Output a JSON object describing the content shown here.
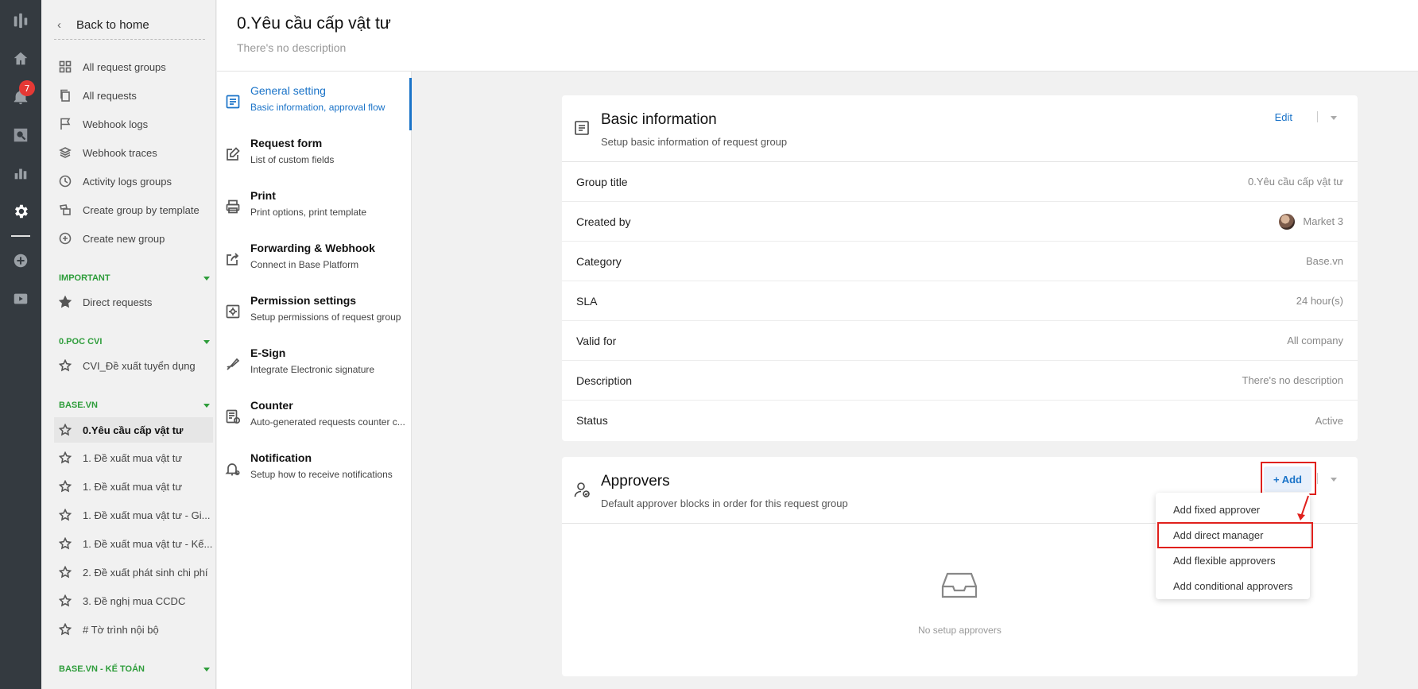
{
  "rail": {
    "notification_count": "7"
  },
  "sidebar": {
    "back_label": "Back to home",
    "menu": [
      {
        "label": "All request groups"
      },
      {
        "label": "All requests"
      },
      {
        "label": "Webhook logs"
      },
      {
        "label": "Webhook traces"
      },
      {
        "label": "Activity logs groups"
      },
      {
        "label": "Create group by template"
      },
      {
        "label": "Create new group"
      }
    ],
    "sections": [
      {
        "title": "IMPORTANT",
        "items": [
          {
            "label": "Direct requests"
          }
        ]
      },
      {
        "title": "0.POC CVI",
        "items": [
          {
            "label": "CVI_Đề xuất tuyển dụng"
          }
        ]
      },
      {
        "title": "BASE.VN",
        "items": [
          {
            "label": "0.Yêu cầu cấp vật tư"
          },
          {
            "label": "1. Đề xuất mua vật tư"
          },
          {
            "label": "1. Đề xuất mua vật tư"
          },
          {
            "label": "1. Đề xuất mua vật tư - Gi..."
          },
          {
            "label": "1. Đề xuất mua vật tư - Kế..."
          },
          {
            "label": "2. Đề xuất phát sinh chi phí"
          },
          {
            "label": "3. Đề nghị mua CCDC"
          },
          {
            "label": "# Tờ trình nội bộ"
          }
        ]
      },
      {
        "title": "BASE.VN - KẾ TOÁN",
        "items": []
      }
    ]
  },
  "header": {
    "title": "0.Yêu cầu cấp vật tư",
    "subtitle": "There's no description"
  },
  "settings_menu": [
    {
      "title": "General setting",
      "desc": "Basic information, approval flow"
    },
    {
      "title": "Request form",
      "desc": "List of custom fields"
    },
    {
      "title": "Print",
      "desc": "Print options, print template"
    },
    {
      "title": "Forwarding & Webhook",
      "desc": "Connect in Base Platform"
    },
    {
      "title": "Permission settings",
      "desc": "Setup permissions of request group"
    },
    {
      "title": "E-Sign",
      "desc": "Integrate Electronic signature"
    },
    {
      "title": "Counter",
      "desc": "Auto-generated requests counter c..."
    },
    {
      "title": "Notification",
      "desc": "Setup how to receive notifications"
    }
  ],
  "basic_info": {
    "title": "Basic information",
    "desc": "Setup basic information of request group",
    "edit_label": "Edit",
    "rows": [
      {
        "key": "Group title",
        "value": "0.Yêu cầu cấp vật tư"
      },
      {
        "key": "Created by",
        "value": "Market 3"
      },
      {
        "key": "Category",
        "value": "Base.vn"
      },
      {
        "key": "SLA",
        "value": "24 hour(s)"
      },
      {
        "key": "Valid for",
        "value": "All company"
      },
      {
        "key": "Description",
        "value": "There's no description"
      },
      {
        "key": "Status",
        "value": "Active"
      }
    ]
  },
  "approvers": {
    "title": "Approvers",
    "desc": "Default approver blocks in order for this request group",
    "add_label": "+ Add",
    "empty_label": "No setup approvers",
    "dropdown": [
      {
        "label": "Add fixed approver"
      },
      {
        "label": "Add direct manager"
      },
      {
        "label": "Add flexible approvers"
      },
      {
        "label": "Add conditional approvers"
      }
    ]
  }
}
